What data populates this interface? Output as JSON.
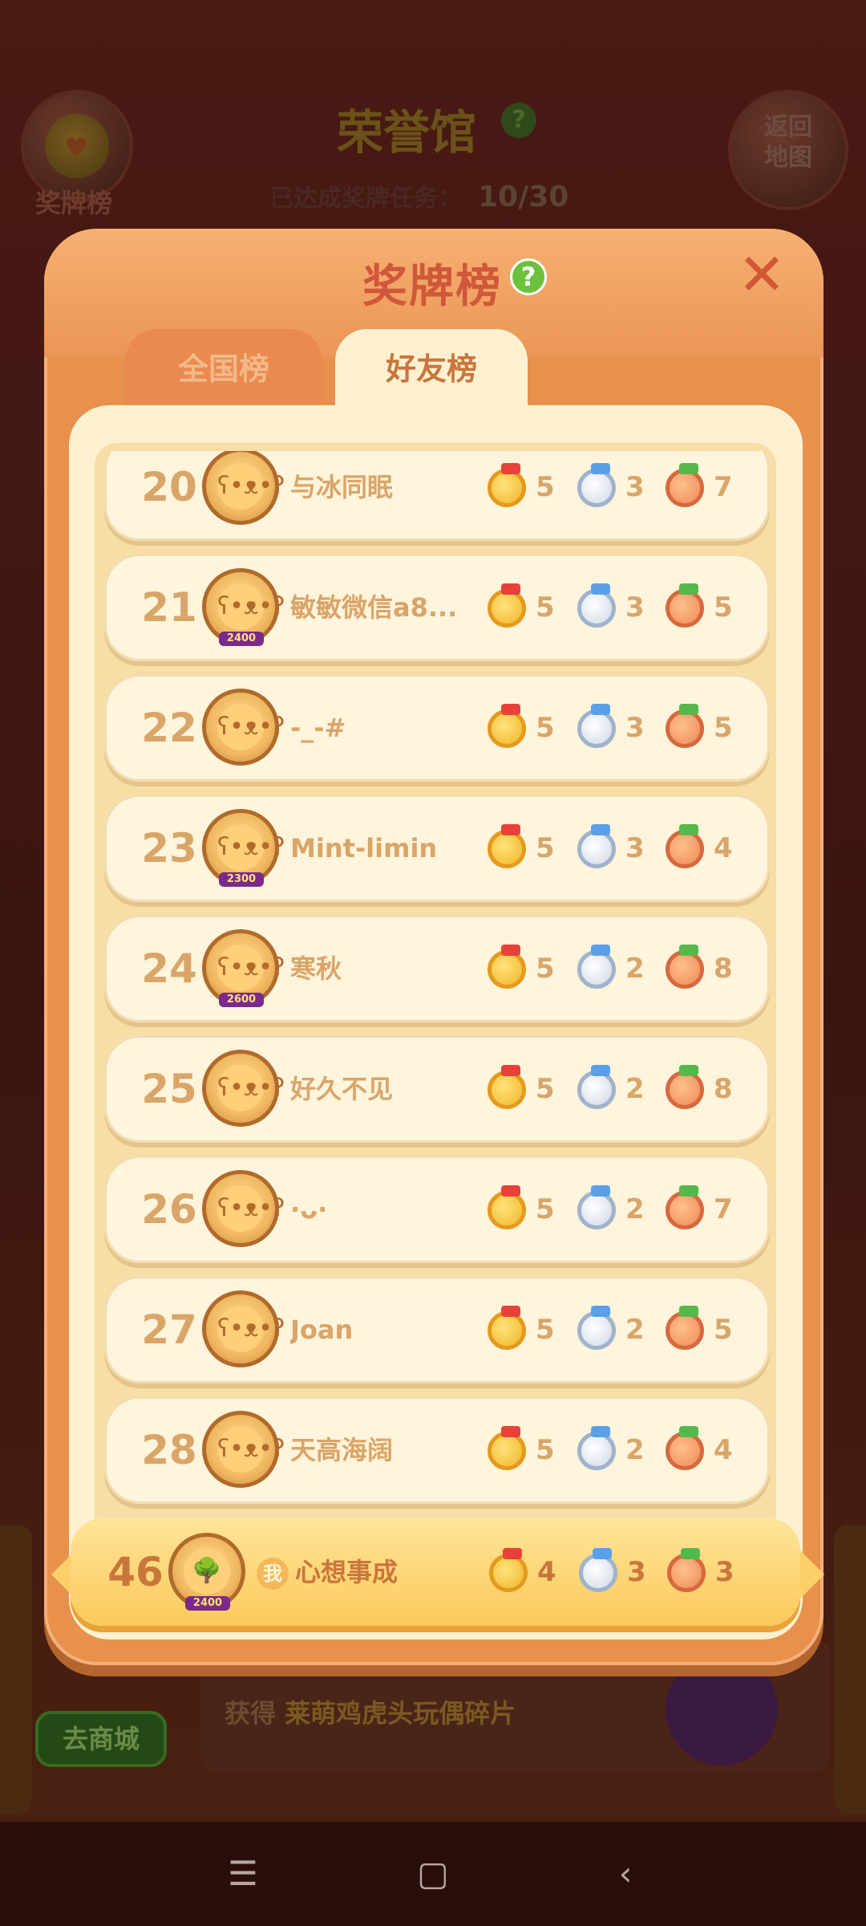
{
  "background": {
    "medal_board_label": "奖牌榜",
    "back_map_label": "返回\n地图",
    "hall_title": "荣誉馆",
    "hall_help": "?",
    "progress_label": "已达成奖牌任务：",
    "progress_value": "10/30",
    "reward_prefix": "获得",
    "reward_item": "莱萌鸡虎头玩偶碎片",
    "shop_button": "去商城"
  },
  "modal": {
    "title": "奖牌榜",
    "help": "?",
    "close": "✕",
    "tabs": [
      {
        "label": "全国榜",
        "active": false
      },
      {
        "label": "好友榜",
        "active": true
      }
    ]
  },
  "leaderboard": [
    {
      "rank": "20",
      "name": "与冰同眠",
      "gold": "5",
      "silver": "3",
      "bronze": "7"
    },
    {
      "rank": "21",
      "name": "敏敏微信a8...",
      "gold": "5",
      "silver": "3",
      "bronze": "5",
      "badge": "2400"
    },
    {
      "rank": "22",
      "name": "-_-#",
      "gold": "5",
      "silver": "3",
      "bronze": "5"
    },
    {
      "rank": "23",
      "name": "Mint-limin",
      "gold": "5",
      "silver": "3",
      "bronze": "4",
      "badge": "2300"
    },
    {
      "rank": "24",
      "name": "寒秋",
      "gold": "5",
      "silver": "2",
      "bronze": "8",
      "badge": "2600"
    },
    {
      "rank": "25",
      "name": "好久不见",
      "gold": "5",
      "silver": "2",
      "bronze": "8"
    },
    {
      "rank": "26",
      "name": "·ᴗ·",
      "gold": "5",
      "silver": "2",
      "bronze": "7"
    },
    {
      "rank": "27",
      "name": "Joan",
      "gold": "5",
      "silver": "2",
      "bronze": "5"
    },
    {
      "rank": "28",
      "name": "天高海阔",
      "gold": "5",
      "silver": "2",
      "bronze": "4"
    }
  ],
  "self": {
    "rank": "46",
    "me_tag": "我",
    "name": "心想事成",
    "badge": "2400",
    "gold": "4",
    "silver": "3",
    "bronze": "3"
  },
  "navbar": {
    "menu_icon": "menu-icon",
    "home_icon": "home-icon",
    "back_icon": "back-icon"
  }
}
